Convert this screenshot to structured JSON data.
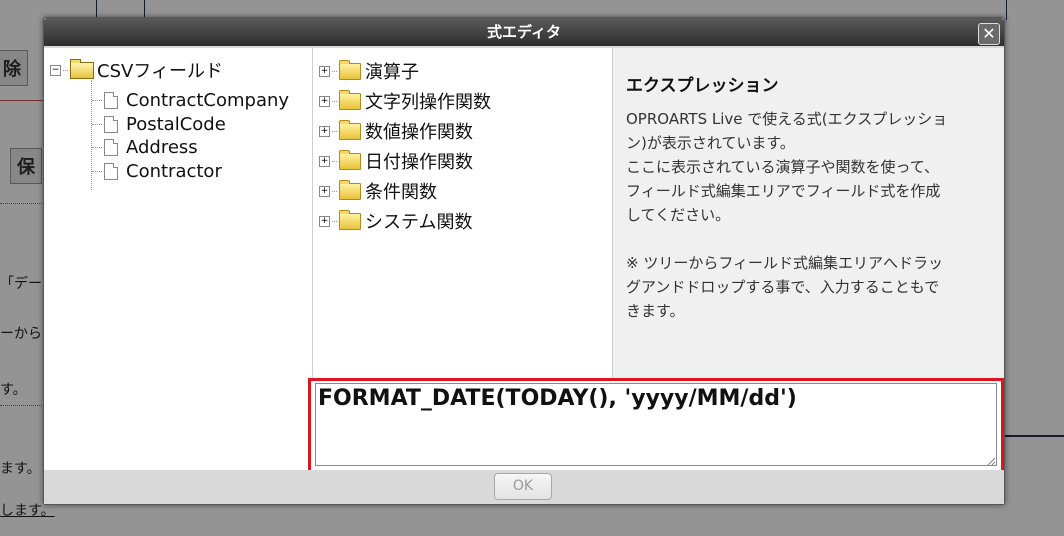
{
  "background": {
    "fragments": [
      "除",
      "保",
      "「デー",
      "ーから",
      "す。",
      "ます。",
      "します。"
    ]
  },
  "dialog": {
    "title": "式エディタ",
    "close_glyph": "✕",
    "field_tree": {
      "root_label": "CSVフィールド",
      "items": [
        "ContractCompany",
        "PostalCode",
        "Address",
        "Contractor"
      ]
    },
    "function_tree": {
      "items": [
        "演算子",
        "文字列操作関数",
        "数値操作関数",
        "日付操作関数",
        "条件関数",
        "システム関数"
      ]
    },
    "description": {
      "title": "エクスプレッション",
      "text": "OPROARTS Live で使える式(エクスプレッショ\nン)が表示されています。\nここに表示されている演算子や関数を使って、\nフィールド式編集エリアでフィールド式を作成\nしてください。\n\n※ ツリーからフィールド式編集エリアへドラッ\nグアンドドロップする事で、入力することもで\nきます。"
    },
    "formula": {
      "value": "FORMAT_DATE(TODAY(), 'yyyy/MM/dd')"
    },
    "ok_label": "OK"
  },
  "colors": {
    "highlight": "#e0141e",
    "titlebar": "#3a3a3a"
  }
}
